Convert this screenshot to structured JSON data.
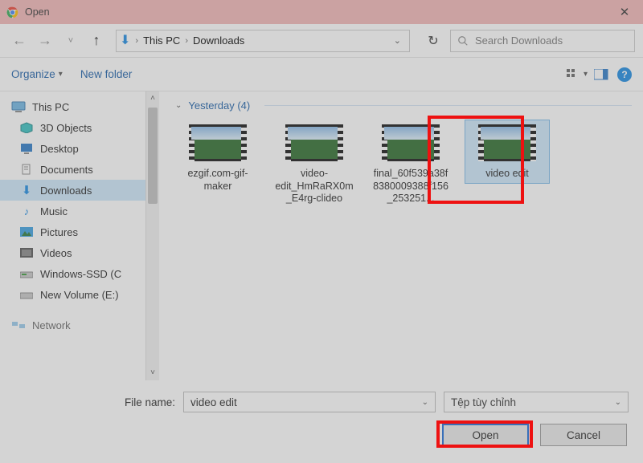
{
  "window": {
    "title": "Open"
  },
  "breadcrumbs": {
    "root": "This PC",
    "folder": "Downloads"
  },
  "search": {
    "placeholder": "Search Downloads"
  },
  "toolbar": {
    "organize": "Organize",
    "new_folder": "New folder"
  },
  "sidebar": {
    "root": "This PC",
    "items": [
      {
        "label": "3D Objects",
        "icon": "cube"
      },
      {
        "label": "Desktop",
        "icon": "desktop"
      },
      {
        "label": "Documents",
        "icon": "doc"
      },
      {
        "label": "Downloads",
        "icon": "download",
        "selected": true
      },
      {
        "label": "Music",
        "icon": "music"
      },
      {
        "label": "Pictures",
        "icon": "pictures"
      },
      {
        "label": "Videos",
        "icon": "video"
      },
      {
        "label": "Windows-SSD (C",
        "icon": "drive"
      },
      {
        "label": "New Volume (E:)",
        "icon": "drive"
      }
    ],
    "extra": "Network"
  },
  "content": {
    "group_label": "Yesterday (4)",
    "files": [
      {
        "label": "ezgif.com-gif-maker"
      },
      {
        "label": "video-edit_HmRaRX0m_E4rg-clideo"
      },
      {
        "label": "final_60f539a38f8380009388f156_253251..."
      },
      {
        "label": "video edit",
        "selected": true
      }
    ]
  },
  "bottom": {
    "filename_label": "File name:",
    "filename_value": "video edit",
    "filter_value": "Tệp tùy chỉnh",
    "open": "Open",
    "cancel": "Cancel"
  }
}
